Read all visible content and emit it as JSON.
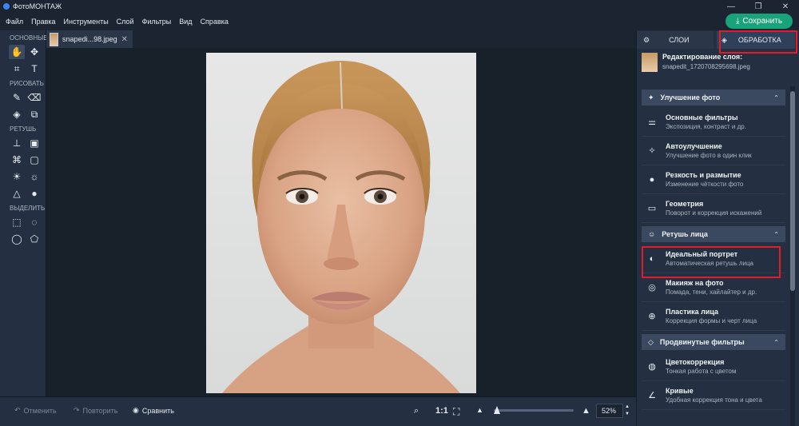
{
  "app": {
    "title": "ФотоМОНТАЖ"
  },
  "window_controls": {
    "minimize": "—",
    "restore": "❐",
    "close": "✕"
  },
  "menu": [
    "Файл",
    "Правка",
    "Инструменты",
    "Слой",
    "Фильтры",
    "Вид",
    "Справка"
  ],
  "save_button": {
    "icon": "⤓",
    "label": "Сохранить",
    "color": "#1aa37a"
  },
  "left_toolbar": {
    "sections": [
      {
        "label": "ОСНОВНЫЕ",
        "tools": [
          {
            "name": "hand-tool-icon",
            "glyph": "✋",
            "active": true
          },
          {
            "name": "move-tool-icon",
            "glyph": "✥",
            "active": false
          },
          {
            "name": "crop-tool-icon",
            "glyph": "⌗",
            "active": false
          },
          {
            "name": "text-tool-icon",
            "glyph": "T",
            "active": false
          }
        ]
      },
      {
        "label": "РИСОВАТЬ",
        "tools": [
          {
            "name": "brush-tool-icon",
            "glyph": "✎",
            "active": false
          },
          {
            "name": "eraser-tool-icon",
            "glyph": "⌫",
            "active": false
          },
          {
            "name": "fill-tool-icon",
            "glyph": "◈",
            "active": false
          },
          {
            "name": "shapes-tool-icon",
            "glyph": "⧉",
            "active": false
          }
        ]
      },
      {
        "label": "РЕТУШЬ",
        "tools": [
          {
            "name": "stamp-tool-icon",
            "glyph": "⊥",
            "active": false
          },
          {
            "name": "patch-tool-icon",
            "glyph": "▣",
            "active": false
          },
          {
            "name": "healing-tool-icon",
            "glyph": "⌘",
            "active": false
          },
          {
            "name": "frame-tool-icon",
            "glyph": "▢",
            "active": false
          },
          {
            "name": "dodge-tool-icon",
            "glyph": "☀",
            "active": false
          },
          {
            "name": "burn-tool-icon",
            "glyph": "☼",
            "active": false
          },
          {
            "name": "sharpen-tool-icon",
            "glyph": "△",
            "active": false
          },
          {
            "name": "blur-tool-icon",
            "glyph": "●",
            "active": false
          }
        ]
      },
      {
        "label": "ВЫДЕЛИТЬ",
        "tools": [
          {
            "name": "rect-select-icon",
            "glyph": "⬚",
            "active": false
          },
          {
            "name": "ellipse-select-icon",
            "glyph": "◌",
            "active": false
          },
          {
            "name": "lasso-select-icon",
            "glyph": "◯",
            "active": false
          },
          {
            "name": "polygon-select-icon",
            "glyph": "⬠",
            "active": false
          }
        ]
      }
    ]
  },
  "document_tab": {
    "name": "snapedi...98.jpeg",
    "close": "✕"
  },
  "bottom_bar": {
    "undo": {
      "icon": "↶",
      "label": "Отменить"
    },
    "redo": {
      "icon": "↷",
      "label": "Повторить"
    },
    "compare": {
      "icon": "◉",
      "label": "Сравнить"
    },
    "ratio": "1:1",
    "fit_icon": "⛶",
    "zoom": "52%",
    "zoom_level": 0.04
  },
  "right_panel": {
    "tabs": {
      "layers": {
        "icon": "⚙",
        "label": "СЛОИ"
      },
      "processing": {
        "icon": "◈",
        "label": "ОБРАБОТКА"
      }
    },
    "layer": {
      "title": "Редактирование слоя:",
      "file": "snapedit_1720708295698.jpeg"
    },
    "categories": [
      {
        "name": "enhance",
        "icon": "✦",
        "title": "Улучшение фото",
        "items": [
          {
            "name": "basic-filters",
            "icon": "⚌",
            "title": "Основные фильтры",
            "subtitle": "Экспозиция, контраст и др."
          },
          {
            "name": "auto-enhance",
            "icon": "✧",
            "title": "Автоулучшение",
            "subtitle": "Улучшение фото в один клик"
          },
          {
            "name": "sharpness-blur",
            "icon": "●",
            "title": "Резкость и размытие",
            "subtitle": "Изменение чёткости фото"
          },
          {
            "name": "geometry",
            "icon": "▭",
            "title": "Геометрия",
            "subtitle": "Поворот и коррекция искажений"
          }
        ]
      },
      {
        "name": "face-retouch",
        "icon": "☺",
        "title": "Ретушь лица",
        "items": [
          {
            "name": "ideal-portrait",
            "icon": "◐",
            "title": "Идеальный портрет",
            "subtitle": "Автоматическая ретушь лица"
          },
          {
            "name": "makeup",
            "icon": "◎",
            "title": "Макияж на фото",
            "subtitle": "Помада, тени, хайлайтер и др."
          },
          {
            "name": "face-plastic",
            "icon": "⊕",
            "title": "Пластика лица",
            "subtitle": "Коррекция формы и черт лица"
          }
        ]
      },
      {
        "name": "advanced-filters",
        "icon": "◇",
        "title": "Продвинутые фильтры",
        "items": [
          {
            "name": "color-correction",
            "icon": "◍",
            "title": "Цветокоррекция",
            "subtitle": "Тонкая работа с цветом"
          },
          {
            "name": "curves",
            "icon": "∠",
            "title": "Кривые",
            "subtitle": "Удобная коррекция тона и цвета"
          }
        ]
      }
    ],
    "chevron": "⌃"
  }
}
